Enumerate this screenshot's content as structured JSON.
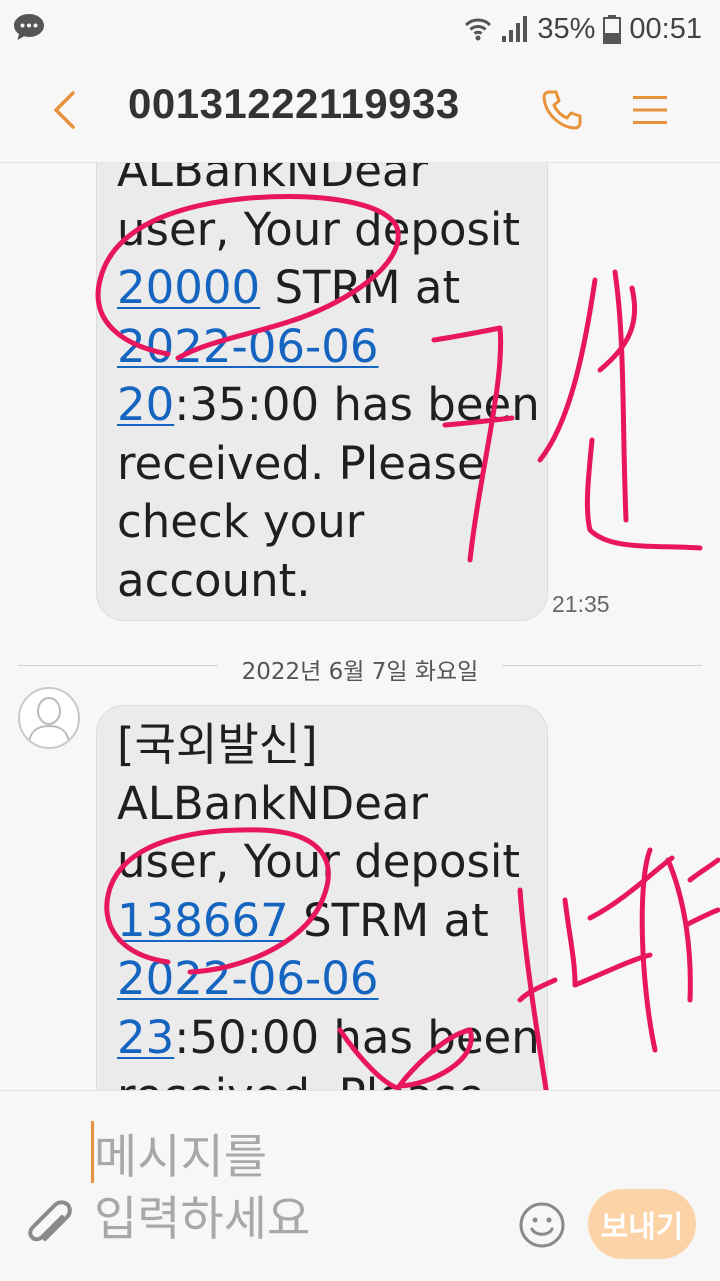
{
  "status_bar": {
    "battery_percent": "35%",
    "time": "00:51",
    "icons": [
      "chat-bubble-icon",
      "wifi-icon",
      "signal-icon",
      "battery-icon"
    ]
  },
  "app_bar": {
    "title": "00131222119933",
    "back_icon": "back-chevron-icon",
    "call_icon": "phone-icon",
    "menu_icon": "hamburger-menu-icon",
    "accent_color": "#e8933a"
  },
  "messages": [
    {
      "lines": [
        {
          "parts": [
            {
              "text": "ALBankNDear",
              "link": false
            }
          ]
        },
        {
          "parts": [
            {
              "text": "user, Your deposit",
              "link": false
            }
          ]
        },
        {
          "parts": [
            {
              "text": "20000",
              "link": true
            },
            {
              "text": " STRM at",
              "link": false
            }
          ]
        },
        {
          "parts": [
            {
              "text": "2022-06-06",
              "link": true
            }
          ]
        },
        {
          "parts": [
            {
              "text": "20",
              "link": true
            },
            {
              "text": ":35:00 has been",
              "link": false
            }
          ]
        },
        {
          "parts": [
            {
              "text": "received. Please",
              "link": false
            }
          ]
        },
        {
          "parts": [
            {
              "text": "check your",
              "link": false
            }
          ]
        },
        {
          "parts": [
            {
              "text": "account.",
              "link": false
            }
          ]
        }
      ],
      "time": "21:35"
    },
    {
      "lines": [
        {
          "parts": [
            {
              "text": "[국외발신]",
              "link": false
            }
          ]
        },
        {
          "parts": [
            {
              "text": "ALBankNDear",
              "link": false
            }
          ]
        },
        {
          "parts": [
            {
              "text": "user, Your deposit",
              "link": false
            }
          ]
        },
        {
          "parts": [
            {
              "text": "138667",
              "link": true
            },
            {
              "text": " STRM at",
              "link": false
            }
          ]
        },
        {
          "parts": [
            {
              "text": "2022-06-06",
              "link": true
            }
          ]
        },
        {
          "parts": [
            {
              "text": "23",
              "link": true
            },
            {
              "text": ":50:00 has been",
              "link": false
            }
          ]
        },
        {
          "parts": [
            {
              "text": "received. Please",
              "link": false
            }
          ]
        }
      ]
    }
  ],
  "date_divider": "2022년 6월 7일 화요일",
  "input": {
    "placeholder_line1": "메시지를",
    "placeholder_line2": "입력하세요",
    "send_label": "보내기",
    "attach_icon": "paperclip-icon",
    "emoji_icon": "emoji-smile-icon"
  },
  "annotations": {
    "color": "#e8175d",
    "handwriting_1": "거짓",
    "handwriting_2": "비탄"
  }
}
